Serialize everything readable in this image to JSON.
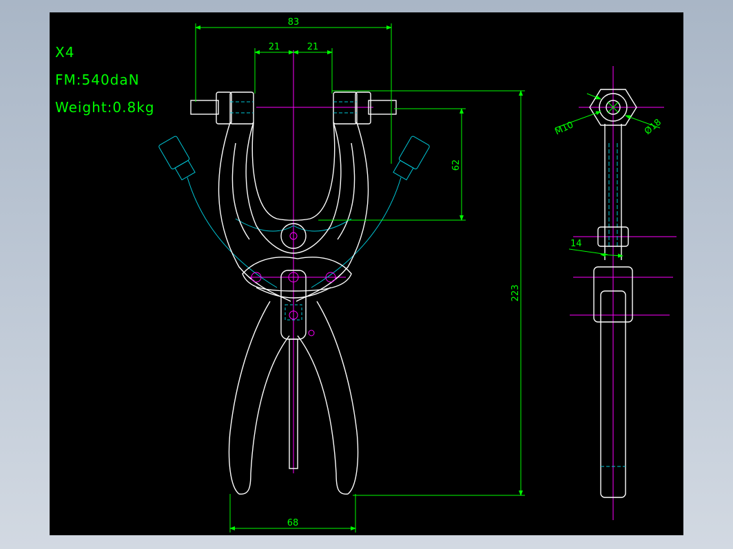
{
  "notes": {
    "model": "X4",
    "force": "FM:540daN",
    "weight": "Weight:0.8kg"
  },
  "dimensions": {
    "overall_width": "83",
    "half_width_left": "21",
    "half_width_right": "21",
    "jaw_depth": "62",
    "overall_height": "223",
    "handle_spread": "68",
    "thread": "M10",
    "hex_diameter": "Ø18",
    "body_thickness": "14"
  },
  "colors": {
    "background": "#000000",
    "outline": "#ffffff",
    "dimension": "#00ff00",
    "centerline": "#ff00ff",
    "hidden": "#00c8d8"
  }
}
